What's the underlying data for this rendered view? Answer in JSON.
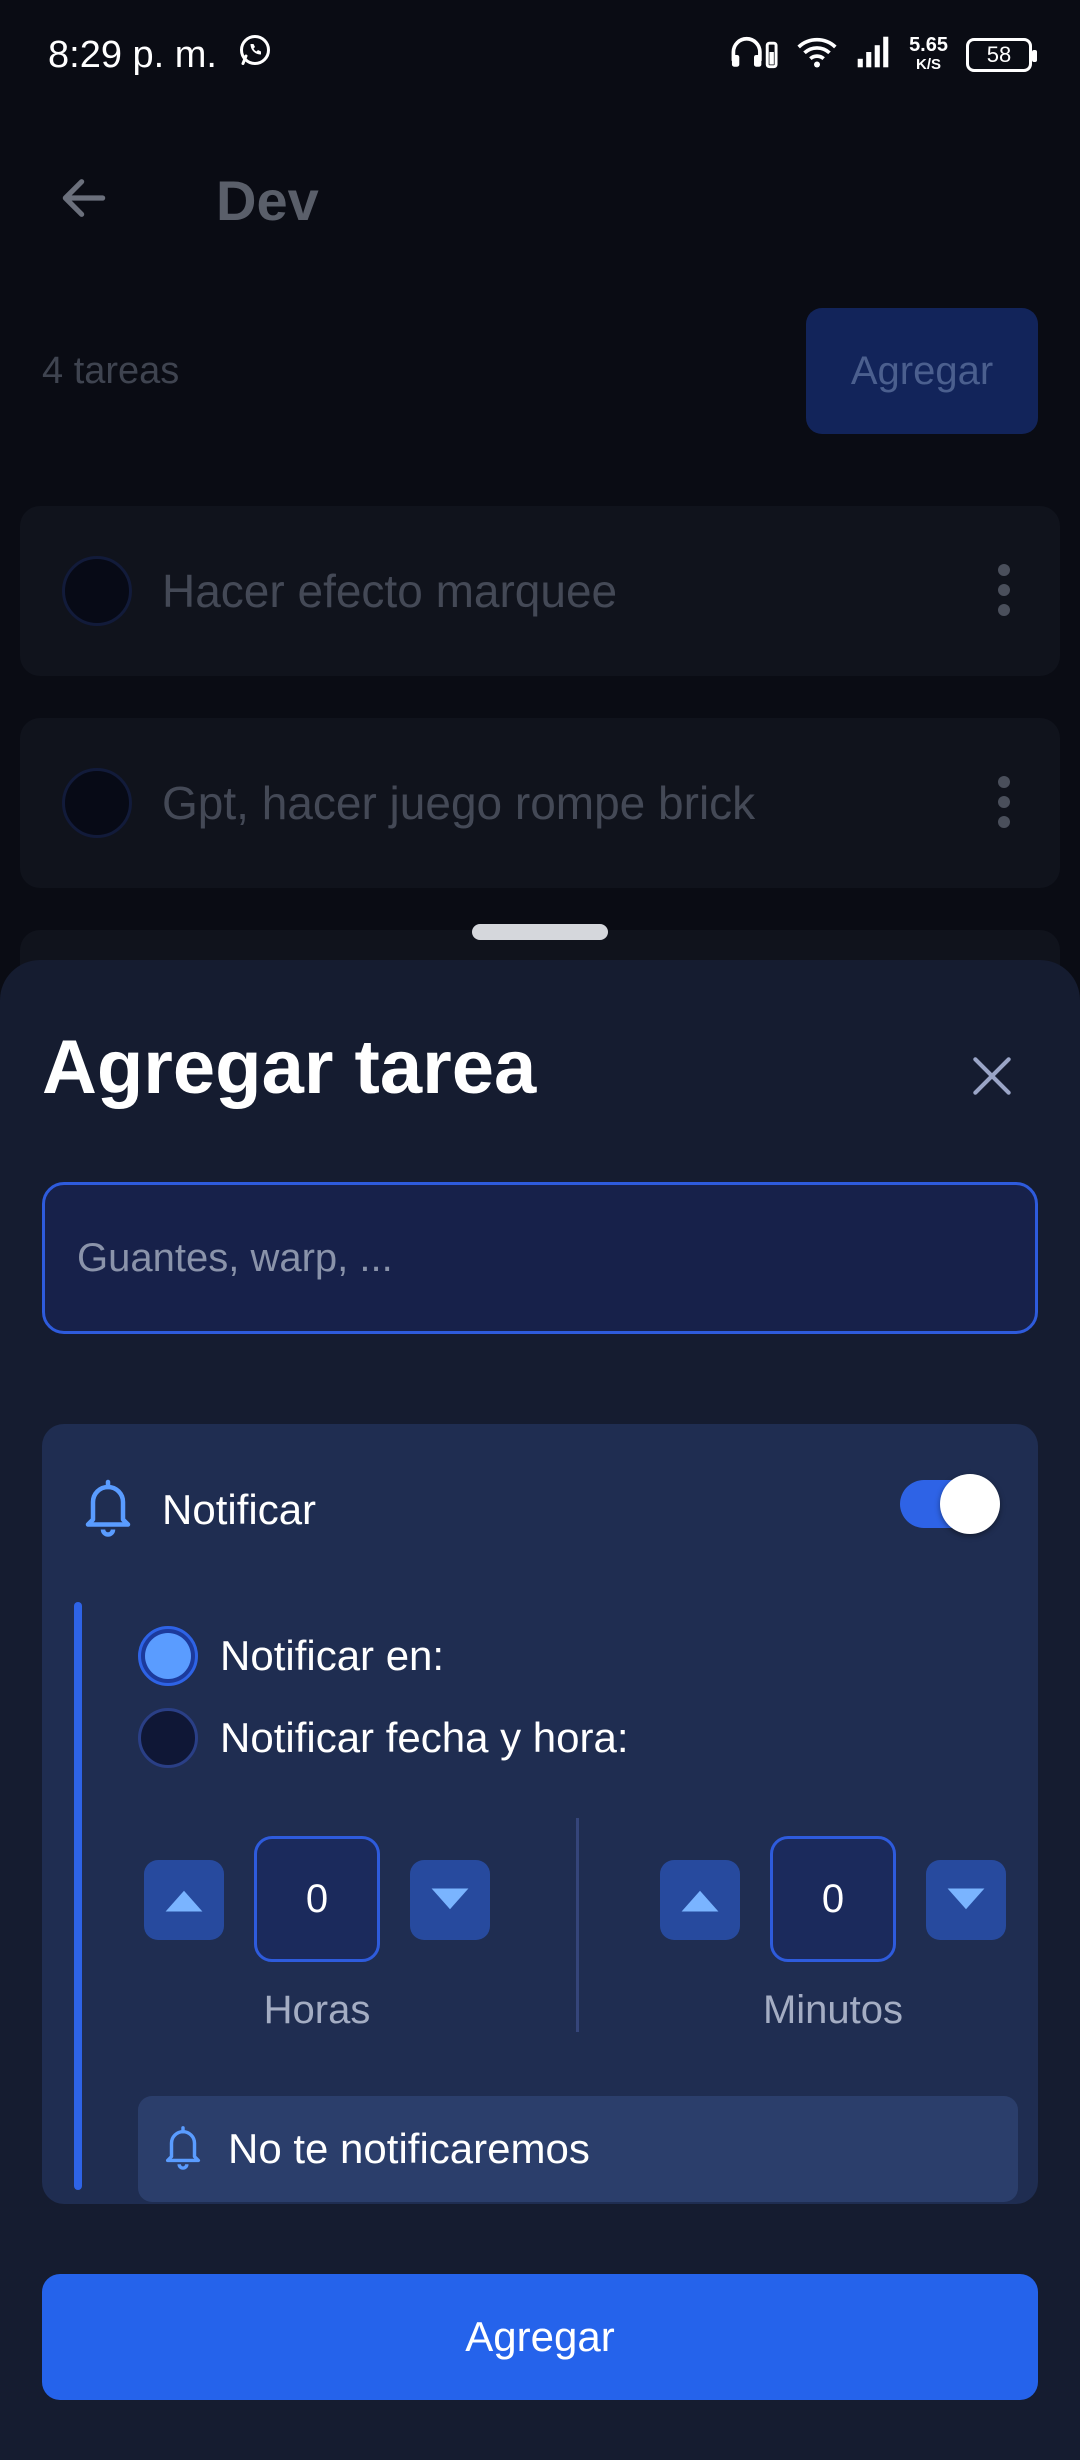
{
  "status_bar": {
    "time": "8:29 p. m.",
    "net_speed_value": "5.65",
    "net_speed_unit": "K/S",
    "battery": "58"
  },
  "background": {
    "title": "Dev",
    "task_count": "4 tareas",
    "add_button": "Agregar",
    "tasks": [
      {
        "label": "Hacer efecto marquee"
      },
      {
        "label": "Gpt, hacer juego rompe brick"
      }
    ]
  },
  "sheet": {
    "title": "Agregar tarea",
    "input": {
      "value": "",
      "placeholder": "Guantes, warp, ..."
    },
    "notify": {
      "label": "Notificar",
      "enabled": true,
      "options": [
        {
          "label": "Notificar en:",
          "selected": true
        },
        {
          "label": "Notificar fecha y hora:",
          "selected": false
        }
      ],
      "hours": {
        "value": "0",
        "label": "Horas"
      },
      "minutes": {
        "value": "0",
        "label": "Minutos"
      },
      "info": "No te notificaremos"
    },
    "submit_button": "Agregar"
  },
  "colors": {
    "accent": "#2563eb",
    "sheet_bg": "#151c30",
    "card_bg": "#1f2d51",
    "radio_selected": "#5a9cff"
  },
  "icons": [
    "whatsapp-icon",
    "headphones-icon",
    "wifi-icon",
    "signal-icon",
    "battery-icon",
    "back-arrow-icon",
    "more-vertical-icon",
    "close-icon",
    "bell-icon",
    "triangle-up-icon",
    "triangle-down-icon"
  ]
}
